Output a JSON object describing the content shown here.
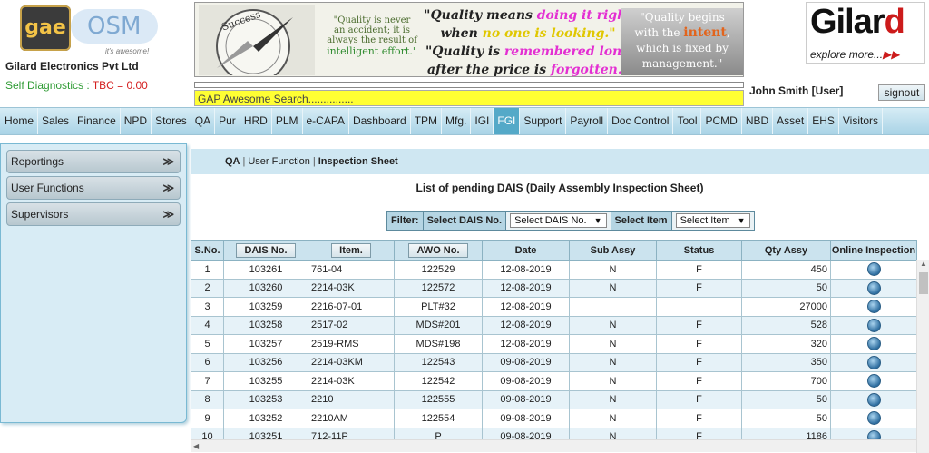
{
  "header": {
    "logo_gae": "gae",
    "logo_osm": "OSM",
    "logo_tagline": "it's awesome!",
    "company": "Gilard Electronics Pvt Ltd",
    "diag_label": "Self Diagnostics : ",
    "diag_value": "TBC = 0.00",
    "banner": {
      "compass_text": "Success",
      "quote1_line1": "\"Quality is never",
      "quote1_line2": "an accident; it is",
      "quote1_line3": "always the result of",
      "quote1_line4": "intelligent effort.\"",
      "quote2_line1_a": "\"Quality means ",
      "quote2_line1_b": "doing it right",
      "quote2_line2_a": "when ",
      "quote2_line2_b": "no one is looking.\"",
      "quote2_line3_a": "\"Quality is ",
      "quote2_line3_b": "remembered long",
      "quote2_line4_a": "after the price is ",
      "quote2_line4_b": "forgotten.\"",
      "quote3_line1": "\"Quality begins",
      "quote3_line2_a": "with the ",
      "quote3_line2_b": "intent",
      "quote3_line2_c": ",",
      "quote3_line3": "which is fixed by",
      "quote3_line4": "management.\""
    },
    "brand_name_a": "Gilar",
    "brand_name_b": "d",
    "brand_sub": "explore more...",
    "brand_arrow": "▶▶",
    "search_placeholder": "GAP Awesome Search...............",
    "user": "John Smith [User]",
    "signout": "signout"
  },
  "nav": [
    "Home",
    "Sales",
    "Finance",
    "NPD",
    "Stores",
    "QA",
    "Pur",
    "HRD",
    "PLM",
    "e-CAPA",
    "Dashboard",
    "TPM",
    "Mfg.",
    "IGI",
    "FGI",
    "Support",
    "Payroll",
    "Doc Control",
    "Tool",
    "PCMD",
    "NBD",
    "Asset",
    "EHS",
    "Visitors"
  ],
  "nav_active": "FGI",
  "sidebar": [
    {
      "label": "Reportings"
    },
    {
      "label": "User Functions"
    },
    {
      "label": "Supervisors"
    }
  ],
  "sidebar_chevron": "≫",
  "breadcrumb": {
    "a": "QA",
    "b": "User Function",
    "c": "Inspection Sheet",
    "sep": "|"
  },
  "list_title": "List of pending DAIS (Daily Assembly Inspection Sheet)",
  "filter": {
    "label": "Filter:",
    "dais_label": "Select DAIS No.",
    "dais_select": "Select DAIS No.",
    "item_label": "Select Item",
    "item_select": "Select Item",
    "arrow": "▼"
  },
  "table": {
    "columns": [
      "S.No.",
      "DAIS No.",
      "Item.",
      "AWO No.",
      "Date",
      "Sub Assy",
      "Status",
      "Qty Assy",
      "Online Inspection"
    ],
    "rows": [
      [
        "1",
        "103261",
        "761-04",
        "122529",
        "12-08-2019",
        "N",
        "F",
        "450"
      ],
      [
        "2",
        "103260",
        "2214-03K",
        "122572",
        "12-08-2019",
        "N",
        "F",
        "50"
      ],
      [
        "3",
        "103259",
        "2216-07-01",
        "PLT#32",
        "12-08-2019",
        "",
        "",
        "27000"
      ],
      [
        "4",
        "103258",
        "2517-02",
        "MDS#201",
        "12-08-2019",
        "N",
        "F",
        "528"
      ],
      [
        "5",
        "103257",
        "2519-RMS",
        "MDS#198",
        "12-08-2019",
        "N",
        "F",
        "320"
      ],
      [
        "6",
        "103256",
        "2214-03KM",
        "122543",
        "09-08-2019",
        "N",
        "F",
        "350"
      ],
      [
        "7",
        "103255",
        "2214-03K",
        "122542",
        "09-08-2019",
        "N",
        "F",
        "700"
      ],
      [
        "8",
        "103253",
        "2210",
        "122555",
        "09-08-2019",
        "N",
        "F",
        "50"
      ],
      [
        "9",
        "103252",
        "2210AM",
        "122554",
        "09-08-2019",
        "N",
        "F",
        "50"
      ],
      [
        "10",
        "103251",
        "712-11P",
        "P",
        "09-08-2019",
        "N",
        "F",
        "1186"
      ]
    ]
  },
  "scroll": {
    "up": "▲",
    "left": "◀"
  }
}
